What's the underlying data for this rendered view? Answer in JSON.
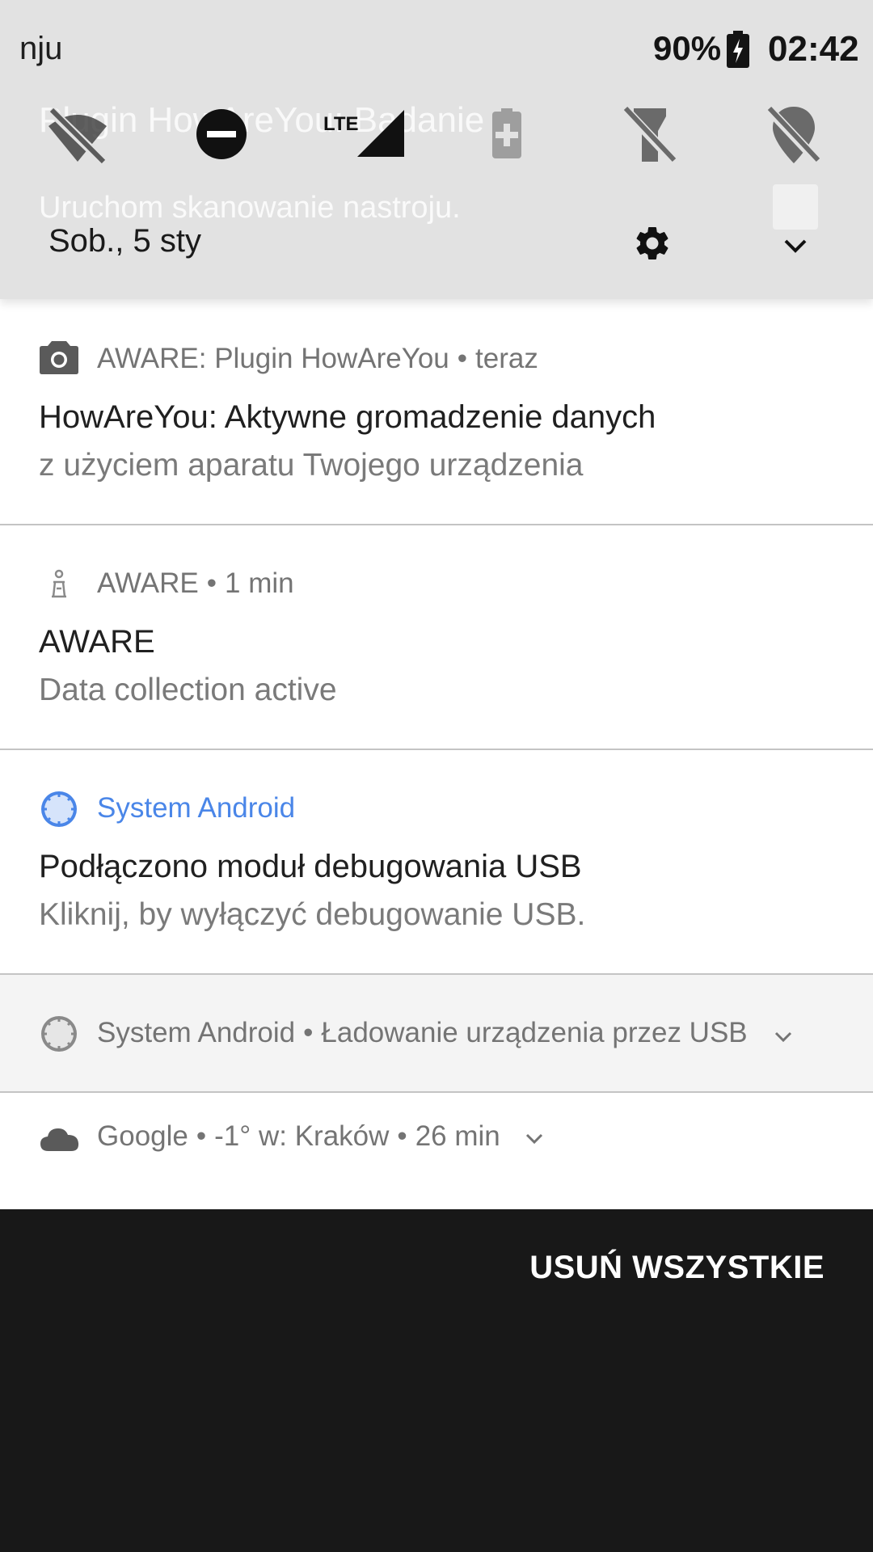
{
  "status_bar": {
    "carrier": "nju",
    "battery_percent": "90%",
    "time": "02:42"
  },
  "background_notification": {
    "title": "Plugin HowAreYou: Badanie",
    "text": "Uruchom skanowanie nastroju."
  },
  "quick_settings": {
    "tiles": [
      {
        "icon": "wifi-off-icon"
      },
      {
        "icon": "do-not-disturb-icon"
      },
      {
        "icon": "lte-signal-icon",
        "label": "LTE"
      },
      {
        "icon": "battery-saver-icon"
      },
      {
        "icon": "flashlight-off-icon"
      },
      {
        "icon": "location-off-icon"
      }
    ],
    "date": "Sob., 5 sty"
  },
  "notifications": [
    {
      "icon": "camera-icon",
      "app": "AWARE: Plugin HowAreYou",
      "time": "teraz",
      "title": "HowAreYou: Aktywne gromadzenie danych",
      "text": "z użyciem aparatu Twojego urządzenia"
    },
    {
      "icon": "aware-app-icon",
      "app": "AWARE",
      "time": "1 min",
      "title": "AWARE",
      "text": "Data collection active"
    },
    {
      "icon": "android-system-icon",
      "app": "System Android",
      "accent": "#4a86e8",
      "title": "Podłączono moduł debugowania USB",
      "text": "Kliknij, by wyłączyć debugowanie USB."
    },
    {
      "icon": "android-system-icon",
      "app": "System Android",
      "summary": "Ładowanie urządzenia przez USB",
      "collapsed": true
    },
    {
      "icon": "cloud-icon",
      "app": "Google",
      "summary": "-1° w: Kraków",
      "time": "26 min",
      "collapsed": true
    }
  ],
  "clear_all_label": "USUŃ WSZYSTKIE"
}
